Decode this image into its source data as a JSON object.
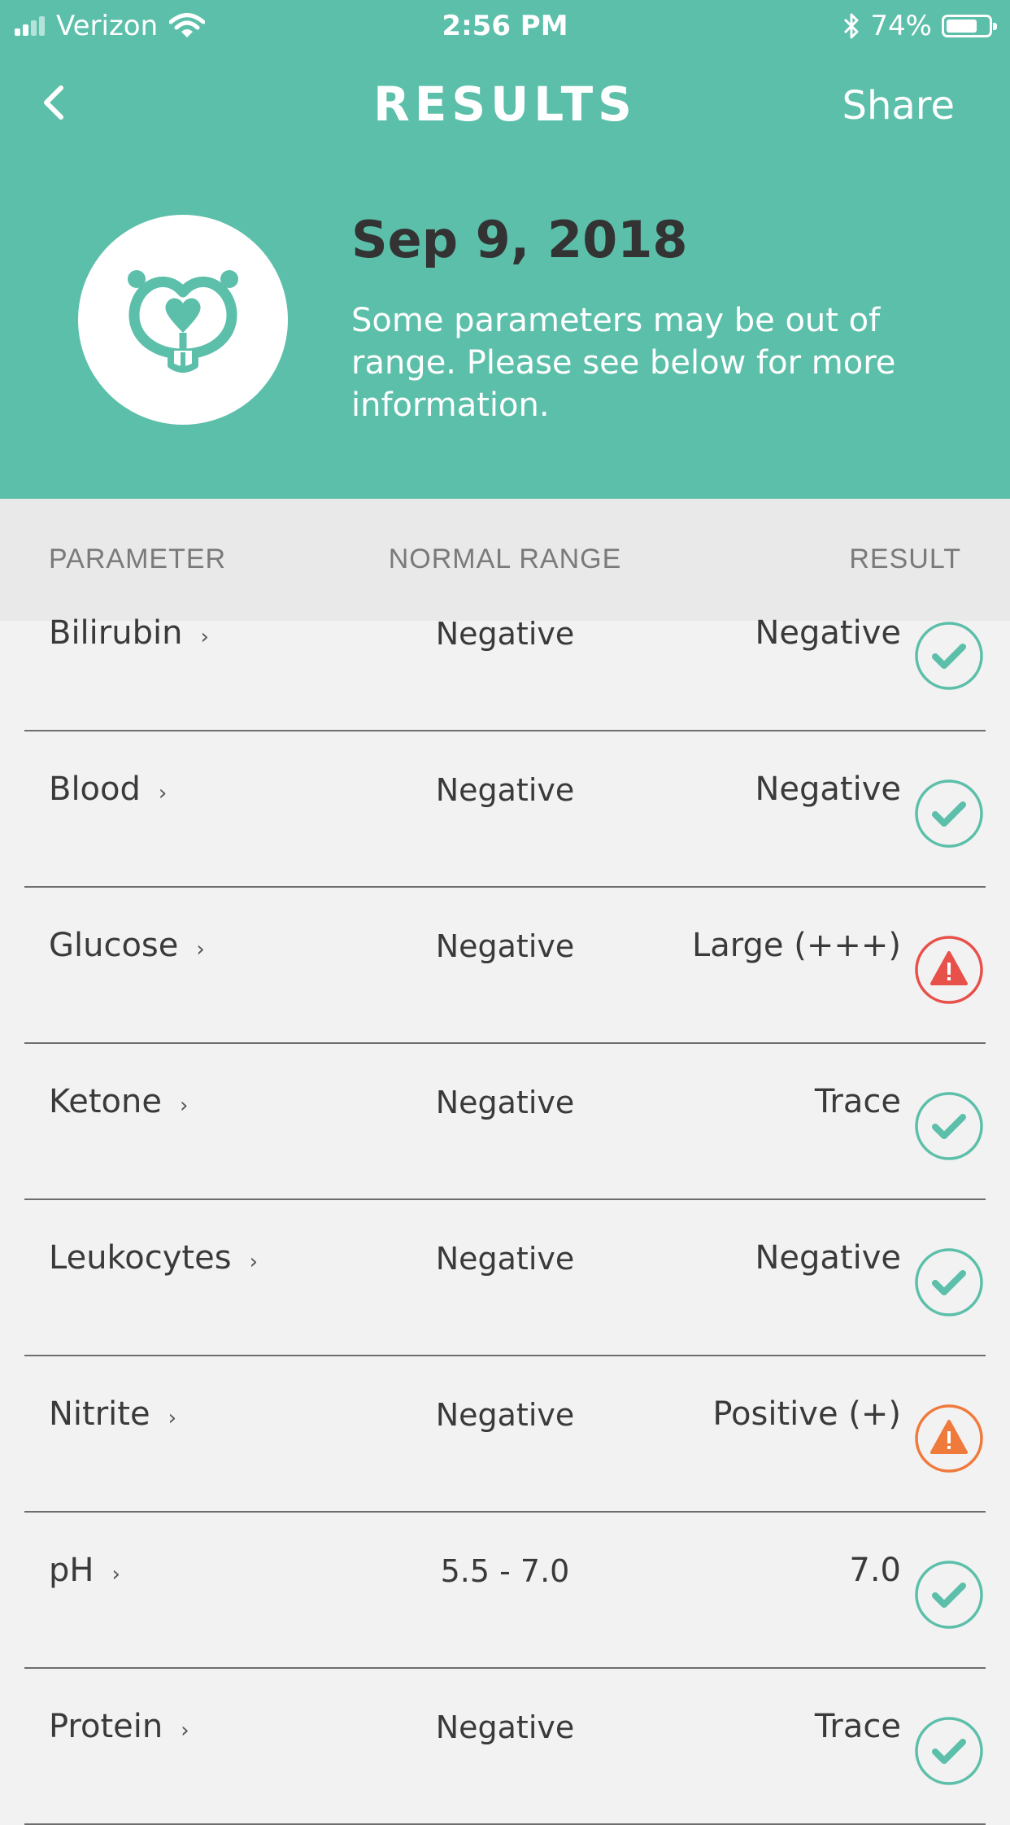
{
  "status_bar": {
    "carrier": "Verizon",
    "time": "2:56 PM",
    "battery_percent": "74%",
    "battery_level": 0.74
  },
  "header": {
    "title": "RESULTS",
    "share_label": "Share",
    "date": "Sep 9, 2018",
    "message": "Some parameters may be out of range. Please see below for more information."
  },
  "table": {
    "columns": [
      "PARAMETER",
      "NORMAL RANGE",
      "RESULT"
    ],
    "rows": [
      {
        "parameter": "Bilirubin",
        "range": "Negative",
        "result": "Negative",
        "status": "ok"
      },
      {
        "parameter": "Blood",
        "range": "Negative",
        "result": "Negative",
        "status": "ok"
      },
      {
        "parameter": "Glucose",
        "range": "Negative",
        "result": "Large (+++)",
        "status": "alert-red"
      },
      {
        "parameter": "Ketone",
        "range": "Negative",
        "result": "Trace",
        "status": "ok"
      },
      {
        "parameter": "Leukocytes",
        "range": "Negative",
        "result": "Negative",
        "status": "ok"
      },
      {
        "parameter": "Nitrite",
        "range": "Negative",
        "result": "Positive (+)",
        "status": "alert-orange"
      },
      {
        "parameter": "pH",
        "range": "5.5 - 7.0",
        "result": "7.0",
        "status": "ok"
      },
      {
        "parameter": "Protein",
        "range": "Negative",
        "result": "Trace",
        "status": "ok"
      }
    ]
  },
  "colors": {
    "accent": "#5cbfaa",
    "ok": "#5cbfaa",
    "alert_red": "#e8504a",
    "alert_orange": "#f07a3c"
  },
  "icons": {
    "back": "chevron-left-icon",
    "logo": "dog-face-logo-icon",
    "ok": "checkmark-circle-icon",
    "warning": "warning-triangle-icon"
  }
}
